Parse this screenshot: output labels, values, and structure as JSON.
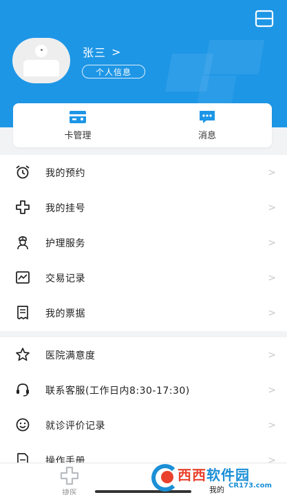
{
  "header": {
    "user_name": "张三",
    "name_chevron": ">",
    "profile_pill": "个人信息",
    "bg_color": "#1e96e6"
  },
  "quick_actions": [
    {
      "label": "卡管理",
      "icon": "card-icon"
    },
    {
      "label": "消息",
      "icon": "message-icon"
    }
  ],
  "menu_primary": [
    {
      "label": "我的预约",
      "icon": "alarm-clock-icon"
    },
    {
      "label": "我的挂号",
      "icon": "medical-cross-icon"
    },
    {
      "label": "护理服务",
      "icon": "nurse-icon"
    },
    {
      "label": "交易记录",
      "icon": "chart-icon"
    },
    {
      "label": "我的票据",
      "icon": "receipt-icon"
    }
  ],
  "menu_secondary": [
    {
      "label": "医院满意度",
      "icon": "star-icon"
    },
    {
      "label": "联系客服(工作日内8:30-17:30)",
      "icon": "headset-icon"
    },
    {
      "label": "就诊评价记录",
      "icon": "smile-icon"
    },
    {
      "label": "操作手册",
      "icon": "manual-icon"
    }
  ],
  "row_arrow": ">",
  "tabbar": {
    "tab1_label": "捷医",
    "tab2_label": "我的"
  },
  "watermark": {
    "brand_red": "西西",
    "brand_blue": "软件园",
    "site": "CR173.com"
  }
}
